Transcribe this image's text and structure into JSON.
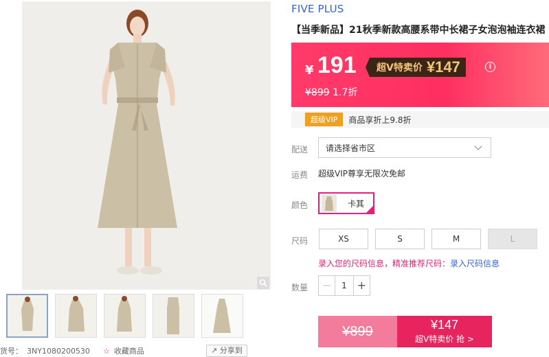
{
  "brand": "FIVE PLUS",
  "title": "【当季新品】21秋季新款高腰系带中长裙子女泡泡袖连衣裙",
  "price": {
    "yen": "¥",
    "current": "191",
    "vip_label": "超V特卖价",
    "vip_price": "¥147",
    "info_icon": "i",
    "original": "¥899",
    "discount": "1.7折"
  },
  "vip_bar": {
    "badge": "超级VIP",
    "text": "商品享折上9.8折"
  },
  "delivery": {
    "label": "配送",
    "placeholder": "请选择省市区"
  },
  "shipping": {
    "label": "运费",
    "text": "超级VIP尊享无限次免邮"
  },
  "color": {
    "label": "颜色",
    "options": [
      "卡其"
    ],
    "selected": "卡其",
    "check": "✓"
  },
  "size": {
    "label": "尺码",
    "options": [
      "XS",
      "S",
      "M",
      "L"
    ],
    "hint": "录入您的尺码信息，精准推荐尺码：",
    "hint_link": "录入尺码信息"
  },
  "quantity": {
    "label": "数量",
    "minus": "−",
    "value": "1",
    "plus": "+"
  },
  "buttons": {
    "normal_price": "¥899",
    "vip_price": "¥147",
    "vip_label": "超V特卖价 抢 >"
  },
  "bottom": {
    "sku_prefix": "货号：",
    "sku": "3NY1080200530",
    "fav": "收藏商品",
    "share": "分享到"
  },
  "colors": {
    "accent": "#e0207a",
    "banner": "#ff3a6a",
    "link": "#3366cc"
  }
}
